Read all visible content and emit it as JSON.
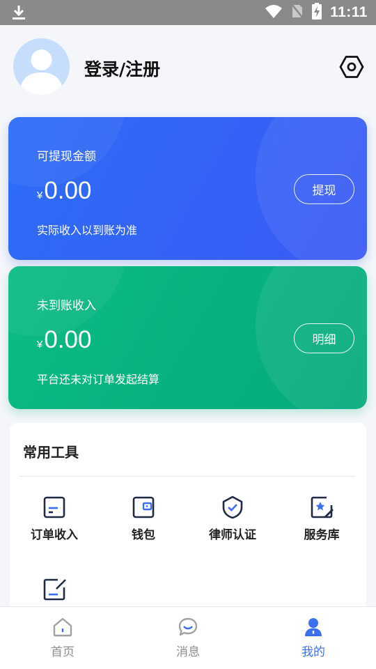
{
  "status_bar": {
    "time": "11:11"
  },
  "profile": {
    "login_label": "登录/注册"
  },
  "balance_card": {
    "label": "可提现金额",
    "currency": "¥",
    "amount": "0.00",
    "note": "实际收入以到账为准",
    "action": "提现"
  },
  "pending_card": {
    "label": "未到账收入",
    "currency": "¥",
    "amount": "0.00",
    "note": "平台还未对订单发起结算",
    "action": "明细"
  },
  "tools": {
    "title": "常用工具",
    "items": [
      {
        "label": "订单收入",
        "icon": "order-income-icon"
      },
      {
        "label": "钱包",
        "icon": "wallet-icon"
      },
      {
        "label": "律师认证",
        "icon": "lawyer-certify-icon"
      },
      {
        "label": "服务库",
        "icon": "service-library-icon"
      },
      {
        "label": "",
        "icon": "edit-icon"
      }
    ]
  },
  "tabbar": {
    "items": [
      {
        "label": "首页",
        "icon": "home-icon"
      },
      {
        "label": "消息",
        "icon": "message-icon"
      },
      {
        "label": "我的",
        "icon": "profile-icon",
        "active": true
      }
    ]
  },
  "colors": {
    "accent": "#3d6ef0",
    "blue_card": "#3a62f6",
    "green_card": "#08b281",
    "icon_navy": "#1f2a44"
  }
}
